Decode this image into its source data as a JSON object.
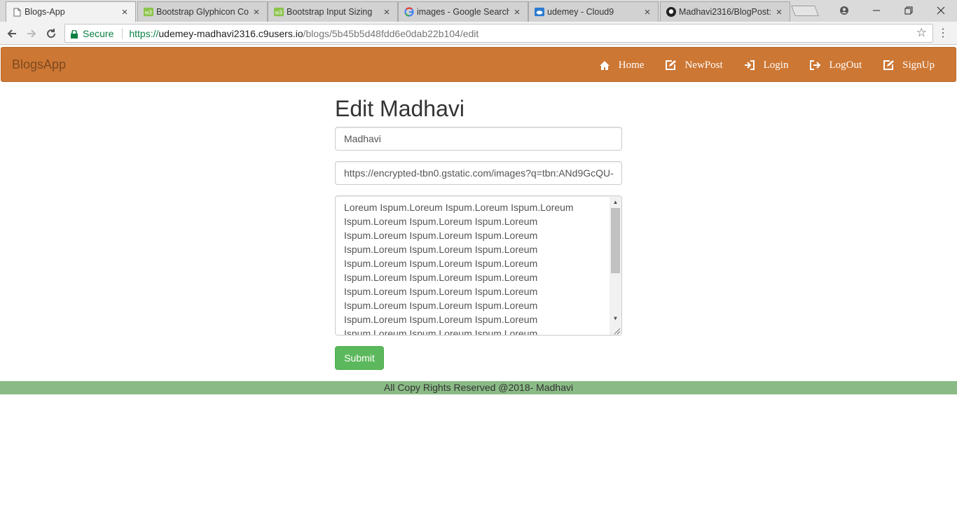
{
  "browser": {
    "tabs": [
      {
        "title": "Blogs-App",
        "icon": "page-icon",
        "active": true
      },
      {
        "title": "Bootstrap Glyphicon Co",
        "icon": "w3schools-icon"
      },
      {
        "title": "Bootstrap Input Sizing",
        "icon": "w3schools-icon"
      },
      {
        "title": "images - Google Search",
        "icon": "google-icon"
      },
      {
        "title": "udemey - Cloud9",
        "icon": "cloud9-icon"
      },
      {
        "title": "Madhavi2316/BlogPost:",
        "icon": "github-icon"
      }
    ],
    "secure_label": "Secure",
    "url_proto": "https://",
    "url_host": "udemey-madhavi2316.c9users.io",
    "url_path": "/blogs/5b45b5d48fdd6e0dab22b104/edit"
  },
  "navbar": {
    "brand": "BlogsApp",
    "links": [
      {
        "label": "Home",
        "icon": "home-icon"
      },
      {
        "label": "NewPost",
        "icon": "edit-icon"
      },
      {
        "label": "Login",
        "icon": "log-in-icon"
      },
      {
        "label": "LogOut",
        "icon": "log-out-icon"
      },
      {
        "label": "SignUp",
        "icon": "edit-icon"
      }
    ]
  },
  "form": {
    "heading": "Edit Madhavi",
    "title_value": "Madhavi",
    "image_value": "https://encrypted-tbn0.gstatic.com/images?q=tbn:ANd9GcQU-",
    "body_lines": [
      "Loreum Ispum.Loreum Ispum.Loreum Ispum.Loreum",
      "Ispum.Loreum Ispum.Loreum Ispum.Loreum",
      "Ispum.Loreum Ispum.Loreum Ispum.Loreum",
      "Ispum.Loreum Ispum.Loreum Ispum.Loreum",
      "Ispum.Loreum Ispum.Loreum Ispum.Loreum",
      "Ispum.Loreum Ispum.Loreum Ispum.Loreum",
      "Ispum.Loreum Ispum.Loreum Ispum.Loreum",
      "Ispum.Loreum Ispum.Loreum Ispum.Loreum",
      "Ispum.Loreum Ispum.Loreum Ispum.Loreum",
      "Ispum.Loreum Ispum.Loreum Ispum.Loreum"
    ],
    "submit_label": "Submit"
  },
  "footer": {
    "text": "All Copy Rights Reserved @2018- Madhavi"
  },
  "colors": {
    "navbar": "#cd7734",
    "footer": "#8abb86",
    "submit": "#5cb85c",
    "secure": "#0b8043"
  }
}
